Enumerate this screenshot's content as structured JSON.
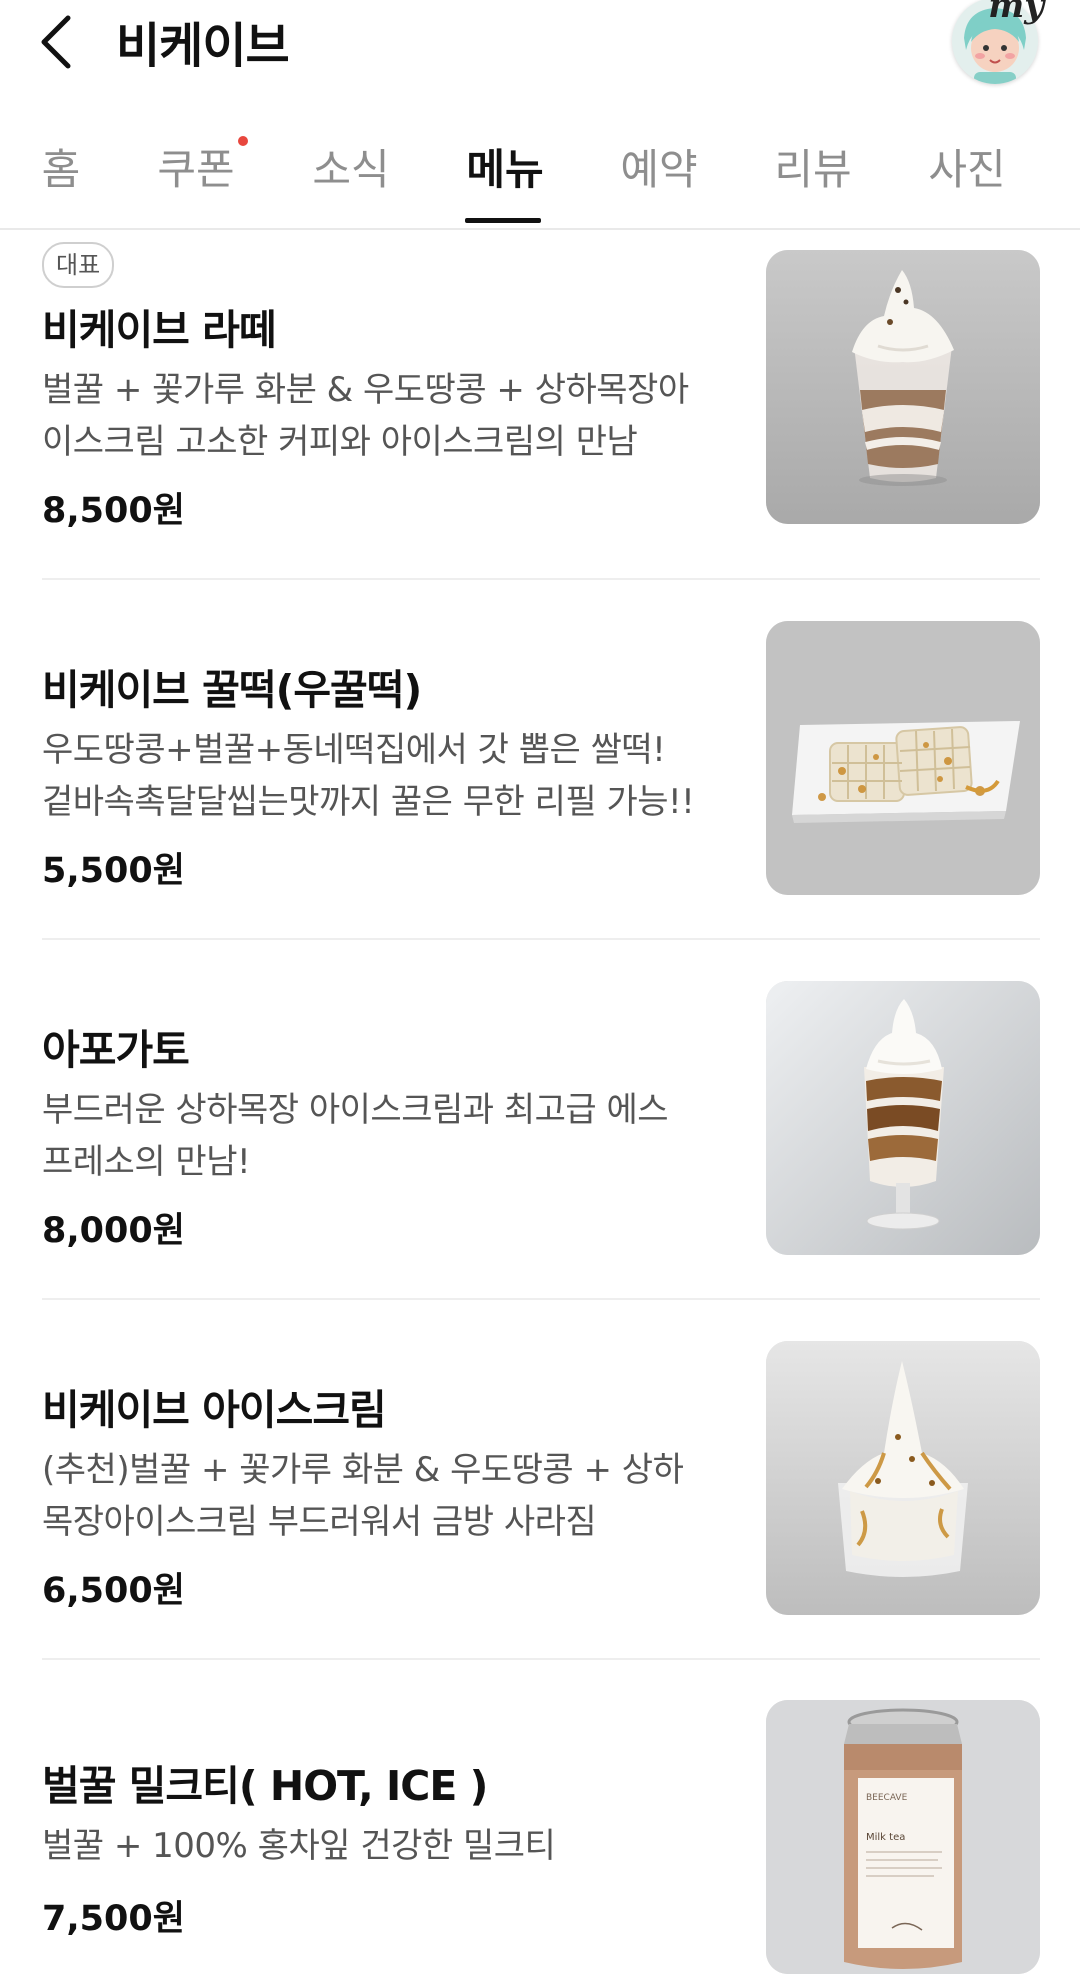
{
  "header": {
    "title": "비케이브",
    "avatar_badge": "my"
  },
  "tabs": [
    {
      "label": "홈",
      "active": false,
      "has_dot": false
    },
    {
      "label": "쿠폰",
      "active": false,
      "has_dot": true
    },
    {
      "label": "소식",
      "active": false,
      "has_dot": false
    },
    {
      "label": "메뉴",
      "active": true,
      "has_dot": false
    },
    {
      "label": "예약",
      "active": false,
      "has_dot": false
    },
    {
      "label": "리뷰",
      "active": false,
      "has_dot": false
    },
    {
      "label": "사진",
      "active": false,
      "has_dot": false
    }
  ],
  "menu": [
    {
      "badge": "대표",
      "name": "비케이브 라떼",
      "desc_lines": [
        "벌꿀 + 꽃가루 화분 & 우도땅콩 + 상하목장아",
        "이스크림 고소한 커피와 아이스크림의 만남"
      ],
      "price": "8,500원"
    },
    {
      "name": "비케이브 꿀떡(우꿀떡)",
      "desc_lines": [
        "우도땅콩+벌꿀+동네떡집에서 갓 뽑은 쌀떡!",
        "겉바속촉달달씹는맛까지 꿀은 무한 리필 가능!!"
      ],
      "price": "5,500원"
    },
    {
      "name": "아포가토",
      "desc_lines": [
        "부드러운 상하목장 아이스크림과 최고급 에스",
        "프레소의 만남!"
      ],
      "price": "8,000원"
    },
    {
      "name": "비케이브 아이스크림",
      "desc_lines": [
        "(추천)벌꿀 + 꽃가루 화분 & 우도땅콩 + 상하",
        "목장아이스크림 부드러워서 금방 사라짐"
      ],
      "price": "6,500원"
    },
    {
      "name": "벌꿀 밀크티( HOT, ICE )",
      "desc_lines": [
        "벌꿀 + 100% 홍차잎 건강한 밀크티"
      ],
      "price": "7,500원"
    }
  ],
  "can_label": {
    "brand": "BEECAVE",
    "product": "Milk tea"
  },
  "colors": {
    "active_tab": "#111111",
    "inactive_tab": "#8e8e8e",
    "notification_dot": "#e8473e",
    "divider": "#eeeeee"
  }
}
